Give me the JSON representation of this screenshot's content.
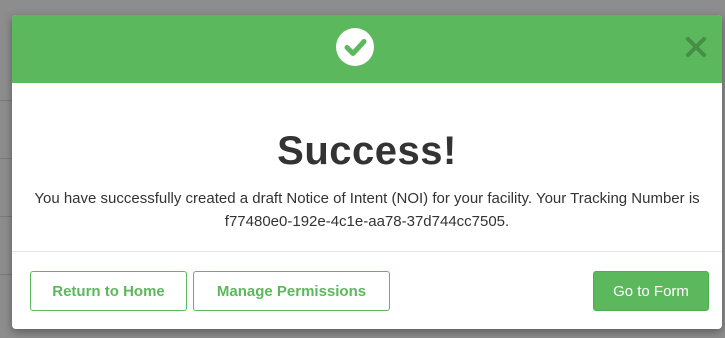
{
  "modal": {
    "title": "Success!",
    "message": "You have successfully created a draft Notice of Intent (NOI) for your facility. Your Tracking Number is f77480e0-192e-4c1e-aa78-37d744cc7505.",
    "header_icon": "check-circle-icon",
    "close_icon": "close-icon"
  },
  "footer": {
    "return_home_label": "Return to Home",
    "manage_permissions_label": "Manage Permissions",
    "go_to_form_label": "Go to Form"
  },
  "colors": {
    "accent": "#5cb85c",
    "text": "#333333",
    "backdrop": "#8d8d8d"
  }
}
